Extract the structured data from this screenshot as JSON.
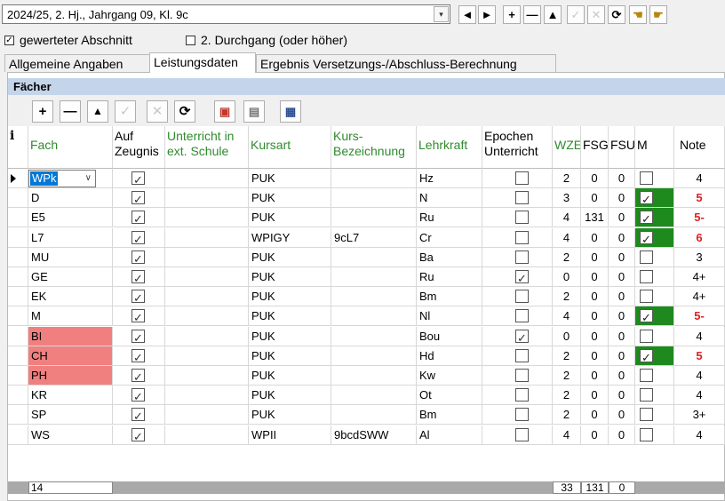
{
  "period": {
    "value": "2024/25, 2. Hj., Jahrgang 09, Kl. 9c"
  },
  "toolbar_top": {
    "buttons": [
      "◄",
      "►",
      "+",
      "—",
      "▲",
      "✓",
      "✕",
      "⟳",
      "icon1",
      "icon2"
    ]
  },
  "options": {
    "gewertet_label": "gewerteter Abschnitt",
    "gewertet_checked": true,
    "durchgang_label": "2. Durchgang (oder höher)",
    "durchgang_checked": false
  },
  "tabs": [
    {
      "label": "Allgemeine Angaben",
      "active": false
    },
    {
      "label": "Leistungsdaten",
      "active": true
    },
    {
      "label": "Ergebnis Versetzungs-/Abschluss-Berechnung",
      "active": false
    }
  ],
  "section_title": "Fächer",
  "toolbar_faecher": {
    "buttons": [
      "+",
      "—",
      "▲",
      "✓",
      "✕",
      "⟳",
      "icon-a",
      "icon-b",
      "icon-c"
    ]
  },
  "table": {
    "headers": {
      "info": "i",
      "fach": "Fach",
      "auf_zeugnis": "Auf Zeugnis",
      "unterricht_ext": "Unterricht in ext. Schule",
      "kursart": "Kursart",
      "kurs_bez": "Kurs-Bezeichnung",
      "lehrkraft": "Lehrkraft",
      "epochen": "Epochen Unterricht",
      "wze": "WZE",
      "fsg": "FSG",
      "fsu": "FSU",
      "m": "M",
      "note": "Note"
    },
    "rows": [
      {
        "fach": "WPk",
        "zeugnis": true,
        "kursart": "PUK",
        "kurs": "",
        "lehrkraft": "Hz",
        "epochen": false,
        "wze": "2",
        "fsg": "0",
        "fsu": "0",
        "m": false,
        "note": "4",
        "red": false,
        "pink": false
      },
      {
        "fach": "D",
        "zeugnis": true,
        "kursart": "PUK",
        "kurs": "",
        "lehrkraft": "N",
        "epochen": false,
        "wze": "3",
        "fsg": "0",
        "fsu": "0",
        "m": true,
        "note": "5",
        "red": true,
        "pink": false
      },
      {
        "fach": "E5",
        "zeugnis": true,
        "kursart": "PUK",
        "kurs": "",
        "lehrkraft": "Ru",
        "epochen": false,
        "wze": "4",
        "fsg": "131",
        "fsu": "0",
        "m": true,
        "note": "5-",
        "red": true,
        "pink": false
      },
      {
        "fach": "L7",
        "zeugnis": true,
        "kursart": "WPIGY",
        "kurs": "9cL7",
        "lehrkraft": "Cr",
        "epochen": false,
        "wze": "4",
        "fsg": "0",
        "fsu": "0",
        "m": true,
        "note": "6",
        "red": true,
        "pink": false
      },
      {
        "fach": "MU",
        "zeugnis": true,
        "kursart": "PUK",
        "kurs": "",
        "lehrkraft": "Ba",
        "epochen": false,
        "wze": "2",
        "fsg": "0",
        "fsu": "0",
        "m": false,
        "note": "3",
        "red": false,
        "pink": false
      },
      {
        "fach": "GE",
        "zeugnis": true,
        "kursart": "PUK",
        "kurs": "",
        "lehrkraft": "Ru",
        "epochen": true,
        "wze": "0",
        "fsg": "0",
        "fsu": "0",
        "m": false,
        "note": "4+",
        "red": false,
        "pink": false
      },
      {
        "fach": "EK",
        "zeugnis": true,
        "kursart": "PUK",
        "kurs": "",
        "lehrkraft": "Bm",
        "epochen": false,
        "wze": "2",
        "fsg": "0",
        "fsu": "0",
        "m": false,
        "note": "4+",
        "red": false,
        "pink": false
      },
      {
        "fach": "M",
        "zeugnis": true,
        "kursart": "PUK",
        "kurs": "",
        "lehrkraft": "Nl",
        "epochen": false,
        "wze": "4",
        "fsg": "0",
        "fsu": "0",
        "m": true,
        "note": "5-",
        "red": true,
        "pink": false
      },
      {
        "fach": "BI",
        "zeugnis": true,
        "kursart": "PUK",
        "kurs": "",
        "lehrkraft": "Bou",
        "epochen": true,
        "wze": "0",
        "fsg": "0",
        "fsu": "0",
        "m": false,
        "note": "4",
        "red": false,
        "pink": true
      },
      {
        "fach": "CH",
        "zeugnis": true,
        "kursart": "PUK",
        "kurs": "",
        "lehrkraft": "Hd",
        "epochen": false,
        "wze": "2",
        "fsg": "0",
        "fsu": "0",
        "m": true,
        "note": "5",
        "red": true,
        "pink": true
      },
      {
        "fach": "PH",
        "zeugnis": true,
        "kursart": "PUK",
        "kurs": "",
        "lehrkraft": "Kw",
        "epochen": false,
        "wze": "2",
        "fsg": "0",
        "fsu": "0",
        "m": false,
        "note": "4",
        "red": false,
        "pink": true
      },
      {
        "fach": "KR",
        "zeugnis": true,
        "kursart": "PUK",
        "kurs": "",
        "lehrkraft": "Ot",
        "epochen": false,
        "wze": "2",
        "fsg": "0",
        "fsu": "0",
        "m": false,
        "note": "4",
        "red": false,
        "pink": false
      },
      {
        "fach": "SP",
        "zeugnis": true,
        "kursart": "PUK",
        "kurs": "",
        "lehrkraft": "Bm",
        "epochen": false,
        "wze": "2",
        "fsg": "0",
        "fsu": "0",
        "m": false,
        "note": "3+",
        "red": false,
        "pink": false
      },
      {
        "fach": "WS",
        "zeugnis": true,
        "kursart": "WPII",
        "kurs": "9bcdSWW",
        "lehrkraft": "Al",
        "epochen": false,
        "wze": "4",
        "fsg": "0",
        "fsu": "0",
        "m": false,
        "note": "4",
        "red": false,
        "pink": false
      }
    ],
    "footer": {
      "count": "14",
      "wze_sum": "33",
      "fsg_sum": "131",
      "fsu_sum": "0"
    }
  },
  "colors": {
    "header_green": "#2e8b2e",
    "red_note": "#e02020",
    "pink": "#f08080",
    "m_green": "#1e8a1e",
    "section_blue": "#c4d5ea"
  }
}
